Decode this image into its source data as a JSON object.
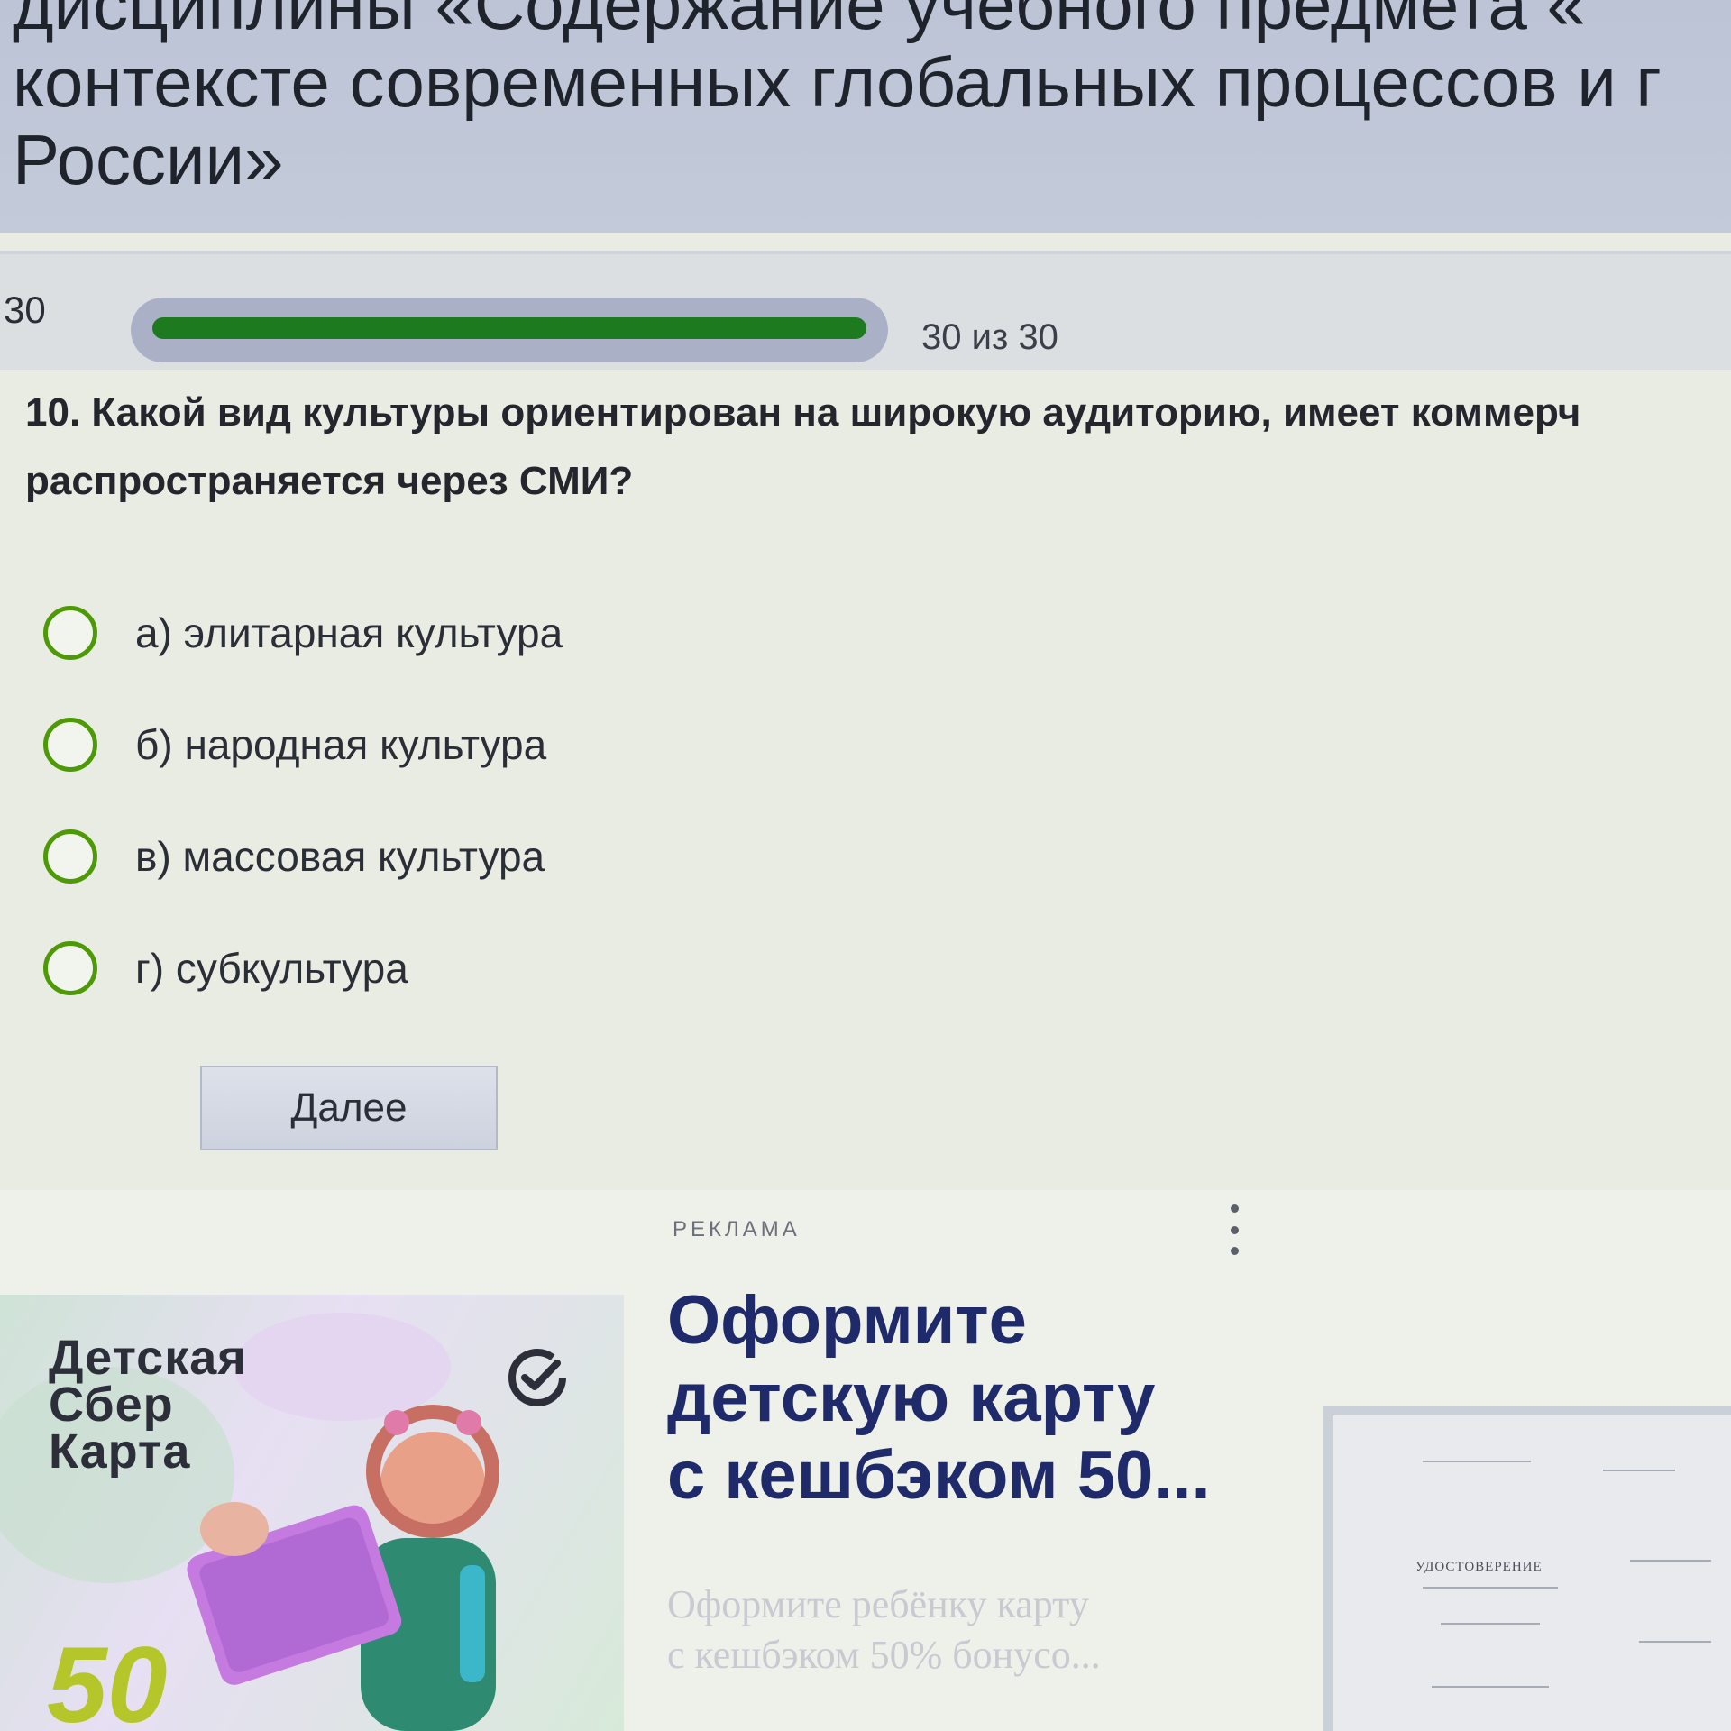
{
  "header": {
    "title_lines": [
      "дисциплины «Содержание учебного предмета «",
      "контексте современных глобальных процессов и г",
      "России»"
    ]
  },
  "progress": {
    "current_label": "30",
    "count_label": "30 из 30",
    "fraction": 1.0,
    "fill_color": "#1e7a1e"
  },
  "question": {
    "lines": [
      "10. Какой вид культуры ориентирован на широкую аудиторию, имеет коммерч",
      "распространяется через СМИ?"
    ]
  },
  "options": [
    {
      "label": "а) элитарная культура"
    },
    {
      "label": "б) народная культура"
    },
    {
      "label": "в) массовая культура"
    },
    {
      "label": "г) субкультура"
    }
  ],
  "next_button": {
    "label": "Далее"
  },
  "ad": {
    "label": "РЕКЛАМА",
    "brand_lines": [
      "Детская",
      "Сбер",
      "Карта"
    ],
    "brand_number": "50",
    "headline_lines": [
      "Оформите",
      "детскую карту",
      "с кешбэком 50..."
    ],
    "subtext_lines": [
      "Оформите ребёнку карту",
      "с кешбэком 50% бонусо..."
    ],
    "certificate_title": "УДОСТОВЕРЕНИЕ"
  }
}
